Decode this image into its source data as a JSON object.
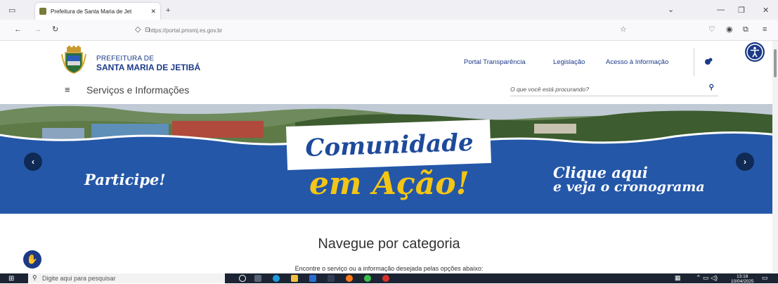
{
  "browser": {
    "tab_title": "Prefeitura de Santa Maria de Jet",
    "tab_close": "✕",
    "new_tab": "+",
    "url": "https://portal.pmsmj.es.gov.br"
  },
  "site": {
    "brand_top": "PREFEITURA DE",
    "brand_main": "SANTA MARIA DE JETIBÁ",
    "top_links": [
      "Portal Transparência",
      "Legislação",
      "Acesso à Informação"
    ],
    "menu_label": "Serviços e Informações",
    "search_placeholder": "O que você está procurando?"
  },
  "banner": {
    "left_text": "Participe!",
    "title_line1": "Comunidade",
    "title_line2": "em Ação!",
    "right_line1": "Clique aqui",
    "right_line2": "e veja o cronograma",
    "prev": "‹",
    "next": "›"
  },
  "content": {
    "category_title": "Navegue por categoria",
    "category_subtitle": "Encontre o serviço ou a informação desejada pelas opções abaixo:"
  },
  "taskbar": {
    "search_placeholder": "Digite aqui para pesquisar",
    "time": "13:18",
    "date": "10/04/2025"
  },
  "colors": {
    "brand_blue": "#1b3a87",
    "banner_blue": "#2457a8",
    "title_yellow": "#f3c515"
  }
}
